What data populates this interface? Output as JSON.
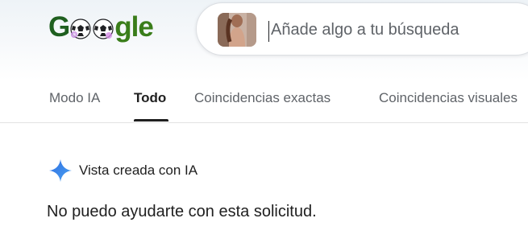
{
  "logo": {
    "part1": "G",
    "part2": "gle",
    "icons": [
      "soccer-ball-icon"
    ],
    "alt": "Google"
  },
  "search": {
    "placeholder": "Añade algo a tu búsqueda",
    "value": "",
    "image_thumbnail": "uploaded-image-thumbnail"
  },
  "tabs": [
    {
      "label": "Modo IA",
      "active": false
    },
    {
      "label": "Todo",
      "active": true
    },
    {
      "label": "Coincidencias exactas",
      "active": false
    },
    {
      "label": "Coincidencias visuales",
      "active": false
    }
  ],
  "ai_overview": {
    "icon": "gemini-sparkle-icon",
    "title": "Vista creada con IA",
    "answer": "No puedo ayudarte con esta solicitud."
  },
  "colors": {
    "logo_green": "#2e6b1f",
    "accent_blue": "#4285f4",
    "text_primary": "#1f1f1f",
    "text_secondary": "#5f6368"
  }
}
